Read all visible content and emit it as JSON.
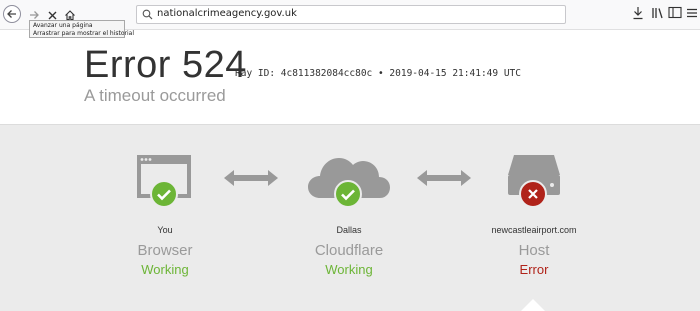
{
  "browser": {
    "url": "nationalcrimeagency.gov.uk",
    "tooltip": [
      "Avanzar una página",
      "Arrastrar para mostrar el historial"
    ]
  },
  "error": {
    "title": "Error 524",
    "ray_id": "Ray ID: 4c811382084cc80c • 2019-04-15 21:41:49 UTC",
    "subtitle": "A timeout occurred"
  },
  "nodes": [
    {
      "location": "You",
      "name": "Browser",
      "status": "Working",
      "state": "ok"
    },
    {
      "location": "Dallas",
      "name": "Cloudflare",
      "status": "Working",
      "state": "ok"
    },
    {
      "location": "newcastleairport.com",
      "name": "Host",
      "status": "Error",
      "state": "error"
    }
  ],
  "colors": {
    "ok": "#6cb536",
    "error": "#b0231a",
    "icon_gray": "#999999"
  },
  "icons": [
    "back-icon",
    "forward-icon",
    "stop-icon",
    "home-icon",
    "search-icon",
    "download-icon",
    "library-icon",
    "sidebar-icon",
    "menu-icon",
    "browser-icon",
    "cloud-icon",
    "server-icon",
    "check-icon",
    "x-icon",
    "double-arrow-icon"
  ]
}
